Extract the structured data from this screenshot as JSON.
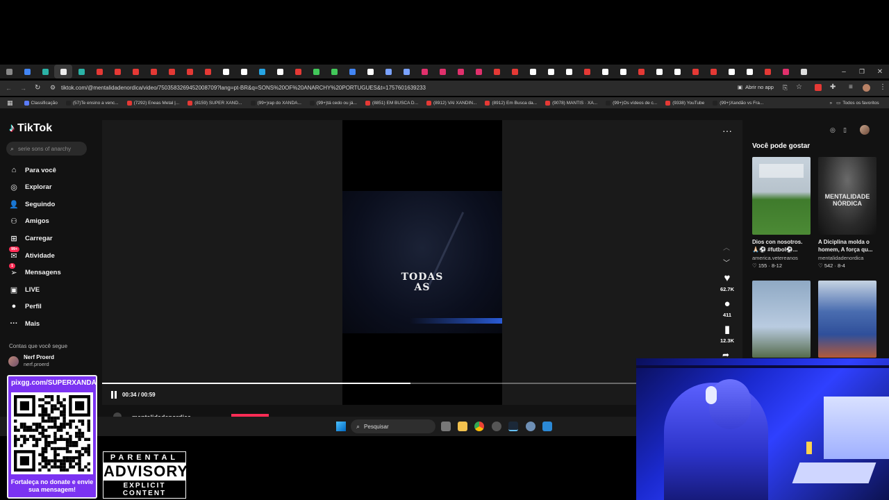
{
  "browser": {
    "url": "tiktok.com/@mentalidadenordica/video/7503583269452008709?lang=pt-BR&q=SONS%20OF%20ANARCHY%20PORTUGUES&t=1757601639233",
    "open_in_app": "Abrir no app",
    "bookmarks": [
      {
        "label": "Classificação",
        "color": "#5b7cff"
      },
      {
        "label": "(57)Te ensino a venc...",
        "color": "#222"
      },
      {
        "label": "(7292) Eneas Metal |...",
        "color": "#e53935"
      },
      {
        "label": "(8159) SUPER XAND...",
        "color": "#e53935"
      },
      {
        "label": "(99+)rap do XANDÃ...",
        "color": "#222"
      },
      {
        "label": "(99+)tá cedo ou já...",
        "color": "#222"
      },
      {
        "label": "(8851) EM BUSCA D...",
        "color": "#e53935"
      },
      {
        "label": "(8912) VAI XANDIN...",
        "color": "#e53935"
      },
      {
        "label": "(8912) Em Busca da...",
        "color": "#e53935"
      },
      {
        "label": "(9078) MANTIS · XA...",
        "color": "#e53935"
      },
      {
        "label": "(99+)Os vídeos de c...",
        "color": "#222"
      },
      {
        "label": "(9338) YouTube",
        "color": "#e53935"
      },
      {
        "label": "(99+)Xandão vs Fra...",
        "color": "#222"
      }
    ],
    "all_favorites": "Todos os favoritos"
  },
  "sidebar": {
    "logo": "TikTok",
    "search_placeholder": "serie sons of anarchy",
    "items": [
      {
        "label": "Para você",
        "icon": "home-icon",
        "glyph": "⌂"
      },
      {
        "label": "Explorar",
        "icon": "compass-icon",
        "glyph": "◎"
      },
      {
        "label": "Seguindo",
        "icon": "following-icon",
        "glyph": "👤"
      },
      {
        "label": "Amigos",
        "icon": "friends-icon",
        "glyph": "⚇"
      },
      {
        "label": "Carregar",
        "icon": "upload-icon",
        "glyph": "⊞"
      },
      {
        "label": "Atividade",
        "icon": "activity-icon",
        "glyph": "✉",
        "badge": "99+"
      },
      {
        "label": "Mensagens",
        "icon": "messages-icon",
        "glyph": "➢",
        "badge": "1"
      },
      {
        "label": "LIVE",
        "icon": "live-icon",
        "glyph": "▣"
      },
      {
        "label": "Perfil",
        "icon": "profile-icon",
        "glyph": "●"
      },
      {
        "label": "Mais",
        "icon": "more-icon",
        "glyph": "···"
      }
    ],
    "following_heading": "Contas que você segue",
    "following": [
      {
        "name": "Nerf Proerd",
        "handle": "nerf.proerd"
      }
    ]
  },
  "video": {
    "overlay_line1": "TODAS",
    "overlay_line2": "AS",
    "time": "00:34 / 00:59",
    "progress": 0.5768,
    "author": "mentalidadenordica"
  },
  "actions": {
    "likes": "62.7K",
    "comments": "411",
    "saves": "12.3K"
  },
  "suggestions": {
    "title": "Você pode gostar",
    "items": [
      {
        "title": "Dios con nosotros. 🙏🏻⚽ #futbol⚽...",
        "author": "america.vetereanos",
        "likes": "155",
        "date": "8-12"
      },
      {
        "title": "A Diciplina molda o homem, A força qu...",
        "author": "mentalidadenordica",
        "likes": "542",
        "date": "8-4",
        "thumb_text": "MENTALIDADE NÓRDICA"
      },
      {
        "title": "",
        "author": "",
        "likes": "",
        "date": ""
      },
      {
        "title": "",
        "author": "",
        "likes": "",
        "date": ""
      }
    ]
  },
  "taskbar": {
    "search": "Pesquisar"
  },
  "overlay": {
    "donation_url": "pixgg.com/SUPERXANDÃ",
    "donation_caption": "Fortaleça no donate e envie sua mensagem!",
    "parental_l1": "PARENTAL",
    "parental_l2": "ADVISORY",
    "parental_l3": "EXPLICIT CONTENT"
  },
  "colors": {
    "accent": "#fe2c55",
    "donation": "#7b33f2"
  }
}
